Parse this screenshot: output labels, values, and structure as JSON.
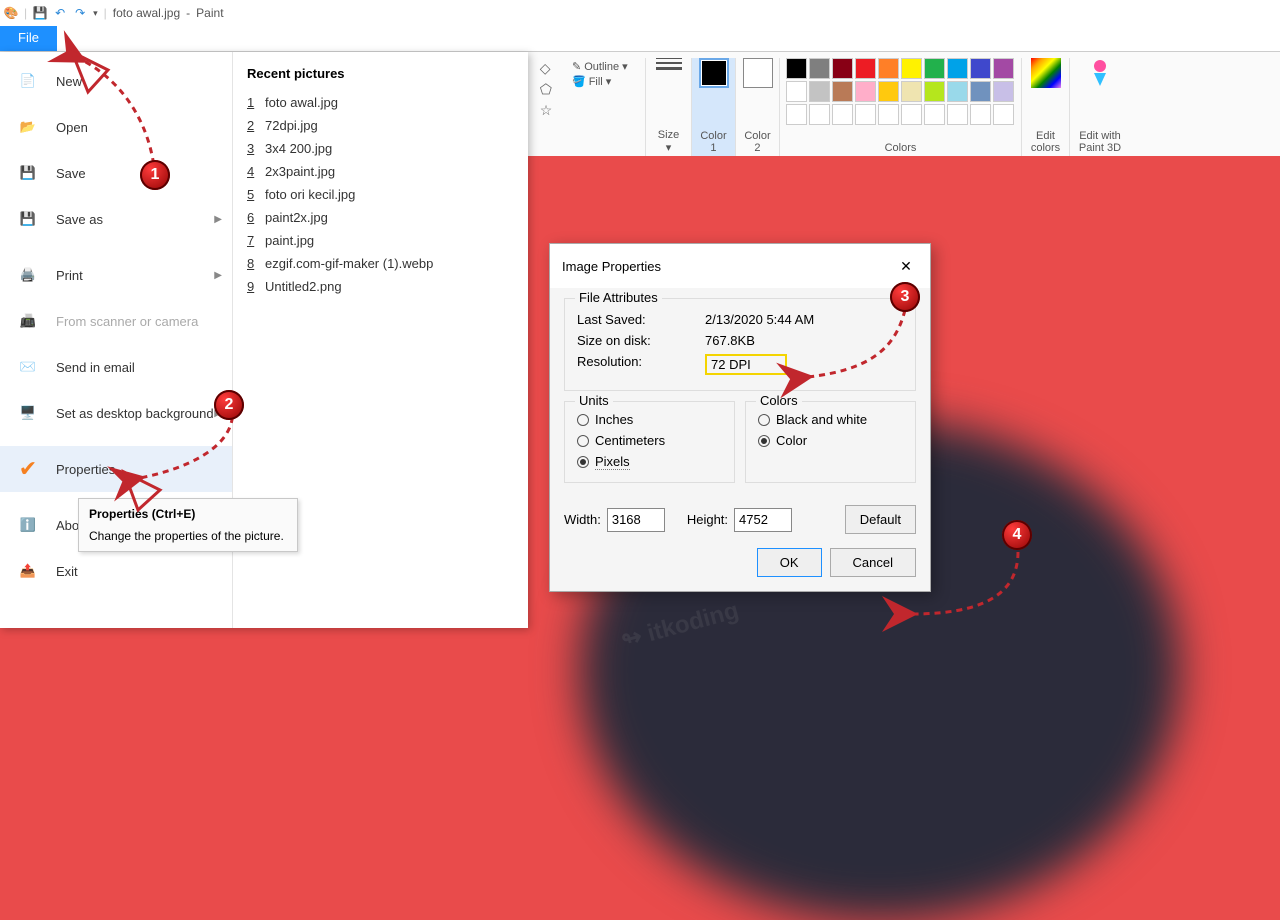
{
  "title": {
    "filename": "foto awal.jpg",
    "app": "Paint"
  },
  "menubar": {
    "file": "File"
  },
  "ribbon": {
    "outline": "Outline",
    "fill": "Fill",
    "size": "Size",
    "color1": "Color\n1",
    "color2": "Color\n2",
    "edit_colors": "Edit\ncolors",
    "edit_3d": "Edit with\nPaint 3D",
    "colors_label": "Colors",
    "palette": [
      "#000000",
      "#7f7f7f",
      "#880015",
      "#ed1c24",
      "#ff7f27",
      "#fff200",
      "#22b14c",
      "#00a2e8",
      "#3f48cc",
      "#a349a4",
      "#ffffff",
      "#c3c3c3",
      "#b97a57",
      "#ffaec9",
      "#ffc90e",
      "#efe4b0",
      "#b5e61d",
      "#99d9ea",
      "#7092be",
      "#c8bfe7",
      "#ffffff",
      "#ffffff",
      "#ffffff",
      "#ffffff",
      "#ffffff",
      "#ffffff",
      "#ffffff",
      "#ffffff",
      "#ffffff",
      "#ffffff"
    ]
  },
  "filemenu": {
    "recent_header": "Recent pictures",
    "items": {
      "new": "New",
      "open": "Open",
      "save": "Save",
      "saveas": "Save as",
      "print": "Print",
      "scanner": "From scanner or camera",
      "email": "Send in email",
      "desktop": "Set as desktop background",
      "properties": "Properties",
      "about": "About Paint",
      "exit": "Exit"
    },
    "recent": [
      "foto awal.jpg",
      "72dpi.jpg",
      "3x4 200.jpg",
      "2x3paint.jpg",
      "foto ori kecil.jpg",
      "paint2x.jpg",
      "paint.jpg",
      "ezgif.com-gif-maker (1).webp",
      "Untitled2.png"
    ]
  },
  "tooltip": {
    "title": "Properties (Ctrl+E)",
    "body": "Change the properties of the picture."
  },
  "dialog": {
    "title": "Image Properties",
    "file_attr": "File Attributes",
    "last_saved_l": "Last Saved:",
    "last_saved_v": "2/13/2020 5:44 AM",
    "size_l": "Size on disk:",
    "size_v": "767.8KB",
    "res_l": "Resolution:",
    "res_v": "72 DPI",
    "units": "Units",
    "colors": "Colors",
    "inches": "Inches",
    "cm": "Centimeters",
    "pixels": "Pixels",
    "bw": "Black and white",
    "color": "Color",
    "width_l": "Width:",
    "width_v": "3168",
    "height_l": "Height:",
    "height_v": "4752",
    "default": "Default",
    "ok": "OK",
    "cancel": "Cancel"
  }
}
